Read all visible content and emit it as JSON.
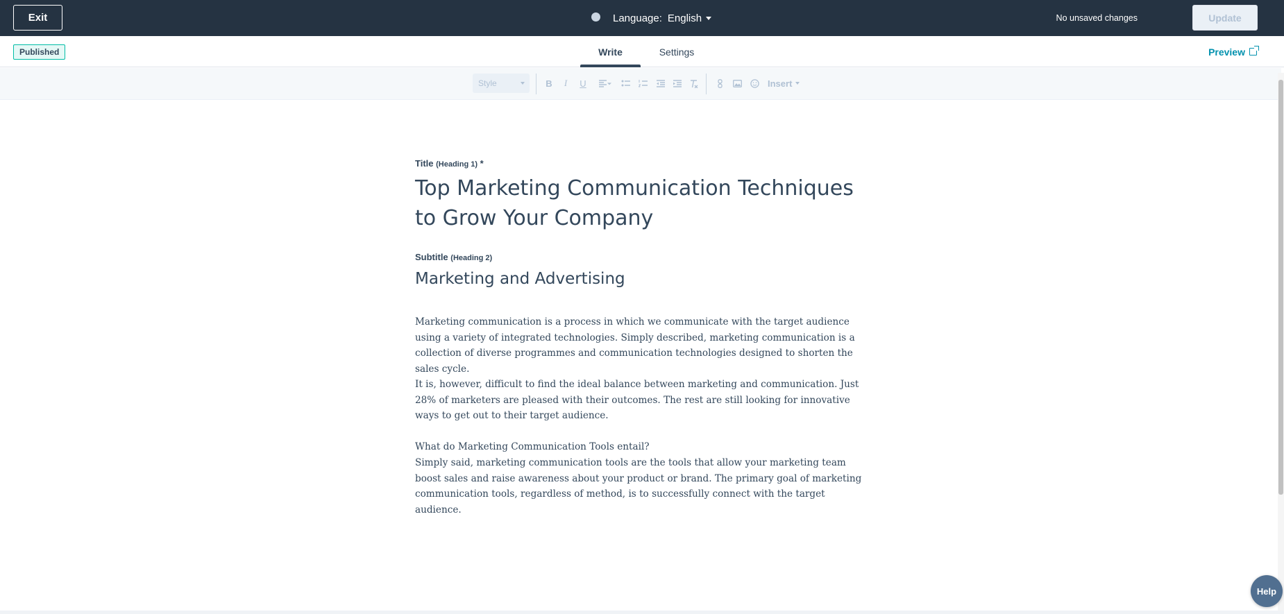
{
  "topbar": {
    "exit_label": "Exit",
    "language_label": "Language:",
    "language_value": "English",
    "save_status": "No unsaved changes",
    "update_label": "Update"
  },
  "tabbar": {
    "status_badge": "Published",
    "tabs": [
      {
        "label": "Write",
        "active": true
      },
      {
        "label": "Settings",
        "active": false
      }
    ],
    "preview_label": "Preview"
  },
  "toolbar": {
    "style_placeholder": "Style",
    "insert_label": "Insert",
    "icons": [
      "bold-icon",
      "italic-icon",
      "underline-icon",
      "align-icon",
      "bulleted-list-icon",
      "numbered-list-icon",
      "outdent-icon",
      "indent-icon",
      "clear-format-icon",
      "link-icon",
      "image-icon",
      "emoji-icon"
    ]
  },
  "editor": {
    "title_label": "Title",
    "title_sublabel": "(Heading 1)",
    "title_required": "*",
    "title": "Top Marketing Communication Techniques to Grow Your Company",
    "subtitle_label": "Subtitle",
    "subtitle_sublabel": "(Heading 2)",
    "subtitle": "Marketing and Advertising",
    "paragraphs": [
      "Marketing communication is a process in which we communicate with the target audience using a variety of integrated technologies. Simply described, marketing communication is a collection of diverse programmes and communication technologies designed to shorten the sales cycle.",
      "It is, however, difficult to find the ideal balance between marketing and communication. Just 28% of marketers are pleased with their outcomes. The rest are still looking for innovative ways to get out to their target audience.",
      "What do Marketing Communication Tools entail?",
      "Simply said, marketing communication tools are the tools that allow your marketing team boost sales and raise awareness about your product or brand. The primary goal of marketing communication tools, regardless of method, is to successfully connect with the target audience."
    ]
  },
  "help_label": "Help",
  "colors": {
    "topbar_bg": "#253342",
    "text": "#33475b",
    "link": "#0091ae",
    "badge_border": "#00bda5",
    "help_bg": "#516f90"
  }
}
